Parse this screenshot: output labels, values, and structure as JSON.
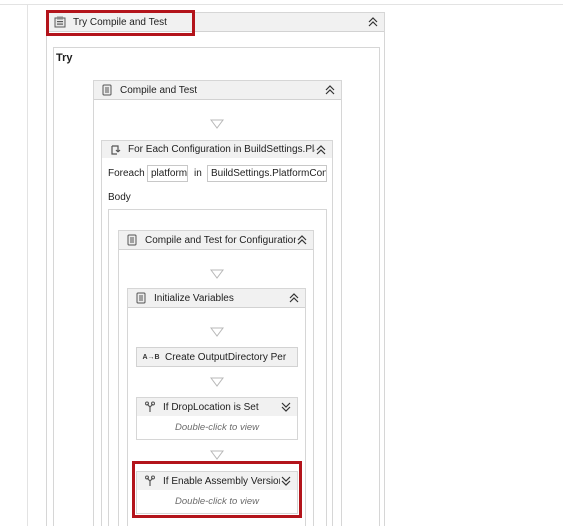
{
  "outer_activity": {
    "title": "Try Compile and Test",
    "icon": "try-catch-icon",
    "toggle": "collapse-double-chevron-up-icon"
  },
  "try_label": "Try",
  "compile_and_test": {
    "title": "Compile and Test",
    "icon": "sequence-icon"
  },
  "for_each": {
    "title": "For Each Configuration in BuildSettings.Plat",
    "icon": "foreach-icon",
    "foreach_label": "Foreach",
    "item_value": "platform",
    "in_label": "in",
    "collection_value": "BuildSettings.PlatformCon",
    "body_label": "Body"
  },
  "compile_for_config": {
    "title": "Compile and Test for Configuration",
    "icon": "sequence-icon"
  },
  "initialize_variables": {
    "title": "Initialize Variables",
    "icon": "sequence-icon"
  },
  "create_output_dir": {
    "title": "Create OutputDirectory Per",
    "icon": "assign-icon",
    "icon_text": "A→B"
  },
  "if_drop_location": {
    "title": "If DropLocation is Set",
    "icon": "if-icon",
    "body": "Double-click to view",
    "toggle": "expand-double-chevron-down-icon"
  },
  "if_enable_assembly": {
    "title": "If Enable Assembly Version",
    "icon": "if-icon",
    "body": "Double-click to view",
    "toggle": "expand-double-chevron-down-icon"
  },
  "colors": {
    "highlight": "#b3141b",
    "header_bg": "#f1f1f1",
    "border": "#d6d6d6",
    "arrow": "#b8b8b8"
  }
}
